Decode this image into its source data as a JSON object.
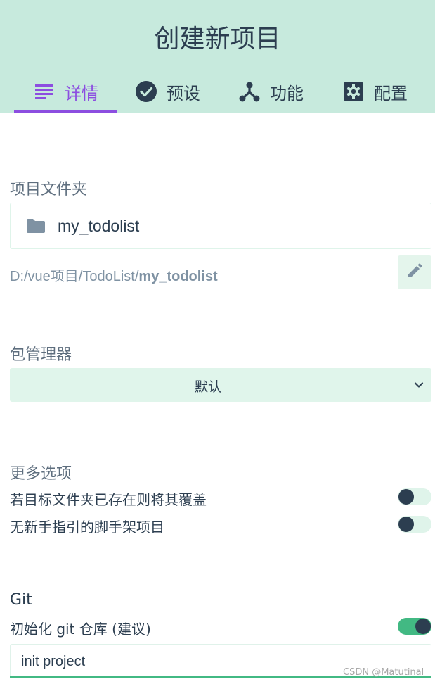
{
  "header": {
    "title": "创建新项目",
    "accent_color": "#8c4ee0",
    "background_color": "#c7eadd"
  },
  "tabs": [
    {
      "label": "详情",
      "icon": "list-icon",
      "active": true
    },
    {
      "label": "预设",
      "icon": "check-circle-icon",
      "active": false
    },
    {
      "label": "功能",
      "icon": "fork-icon",
      "active": false
    },
    {
      "label": "配置",
      "icon": "settings-icon",
      "active": false
    }
  ],
  "project_folder": {
    "label": "项目文件夹",
    "folder_icon": "folder-icon",
    "folder_name": "my_todolist",
    "path_prefix": "D:/vue项目/TodoList/",
    "path_bold": "my_todolist",
    "edit_icon": "pencil-icon"
  },
  "package_manager": {
    "label": "包管理器",
    "selected": "默认",
    "chevron_icon": "chevron-down-icon"
  },
  "more_options": {
    "label": "更多选项",
    "items": [
      {
        "label": "若目标文件夹已存在则将其覆盖",
        "enabled": false
      },
      {
        "label": "无新手指引的脚手架项目",
        "enabled": false
      }
    ]
  },
  "git": {
    "label": "Git",
    "init_label": "初始化 git 仓库 (建议)",
    "init_enabled": true,
    "commit_message": "init project",
    "accent_color": "#42b983"
  },
  "watermark": "CSDN @Matutinal"
}
